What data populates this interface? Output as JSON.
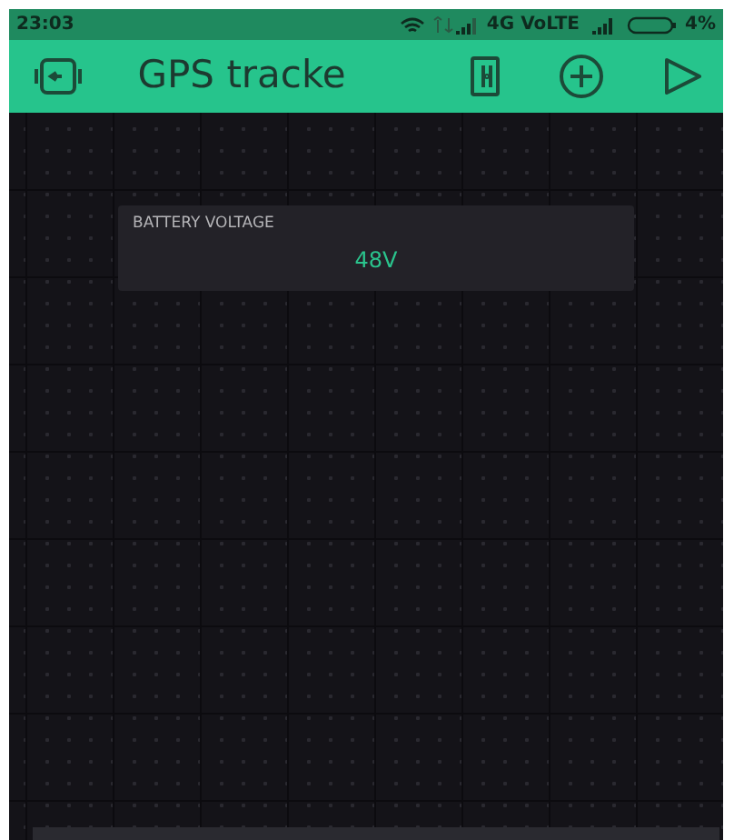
{
  "status_bar": {
    "time": "23:03",
    "network": "4G VoLTE",
    "battery": "4%"
  },
  "toolbar": {
    "title": "GPS tracke"
  },
  "widgets": [
    {
      "label": "BATTERY VOLTAGE",
      "value": "48V"
    }
  ]
}
